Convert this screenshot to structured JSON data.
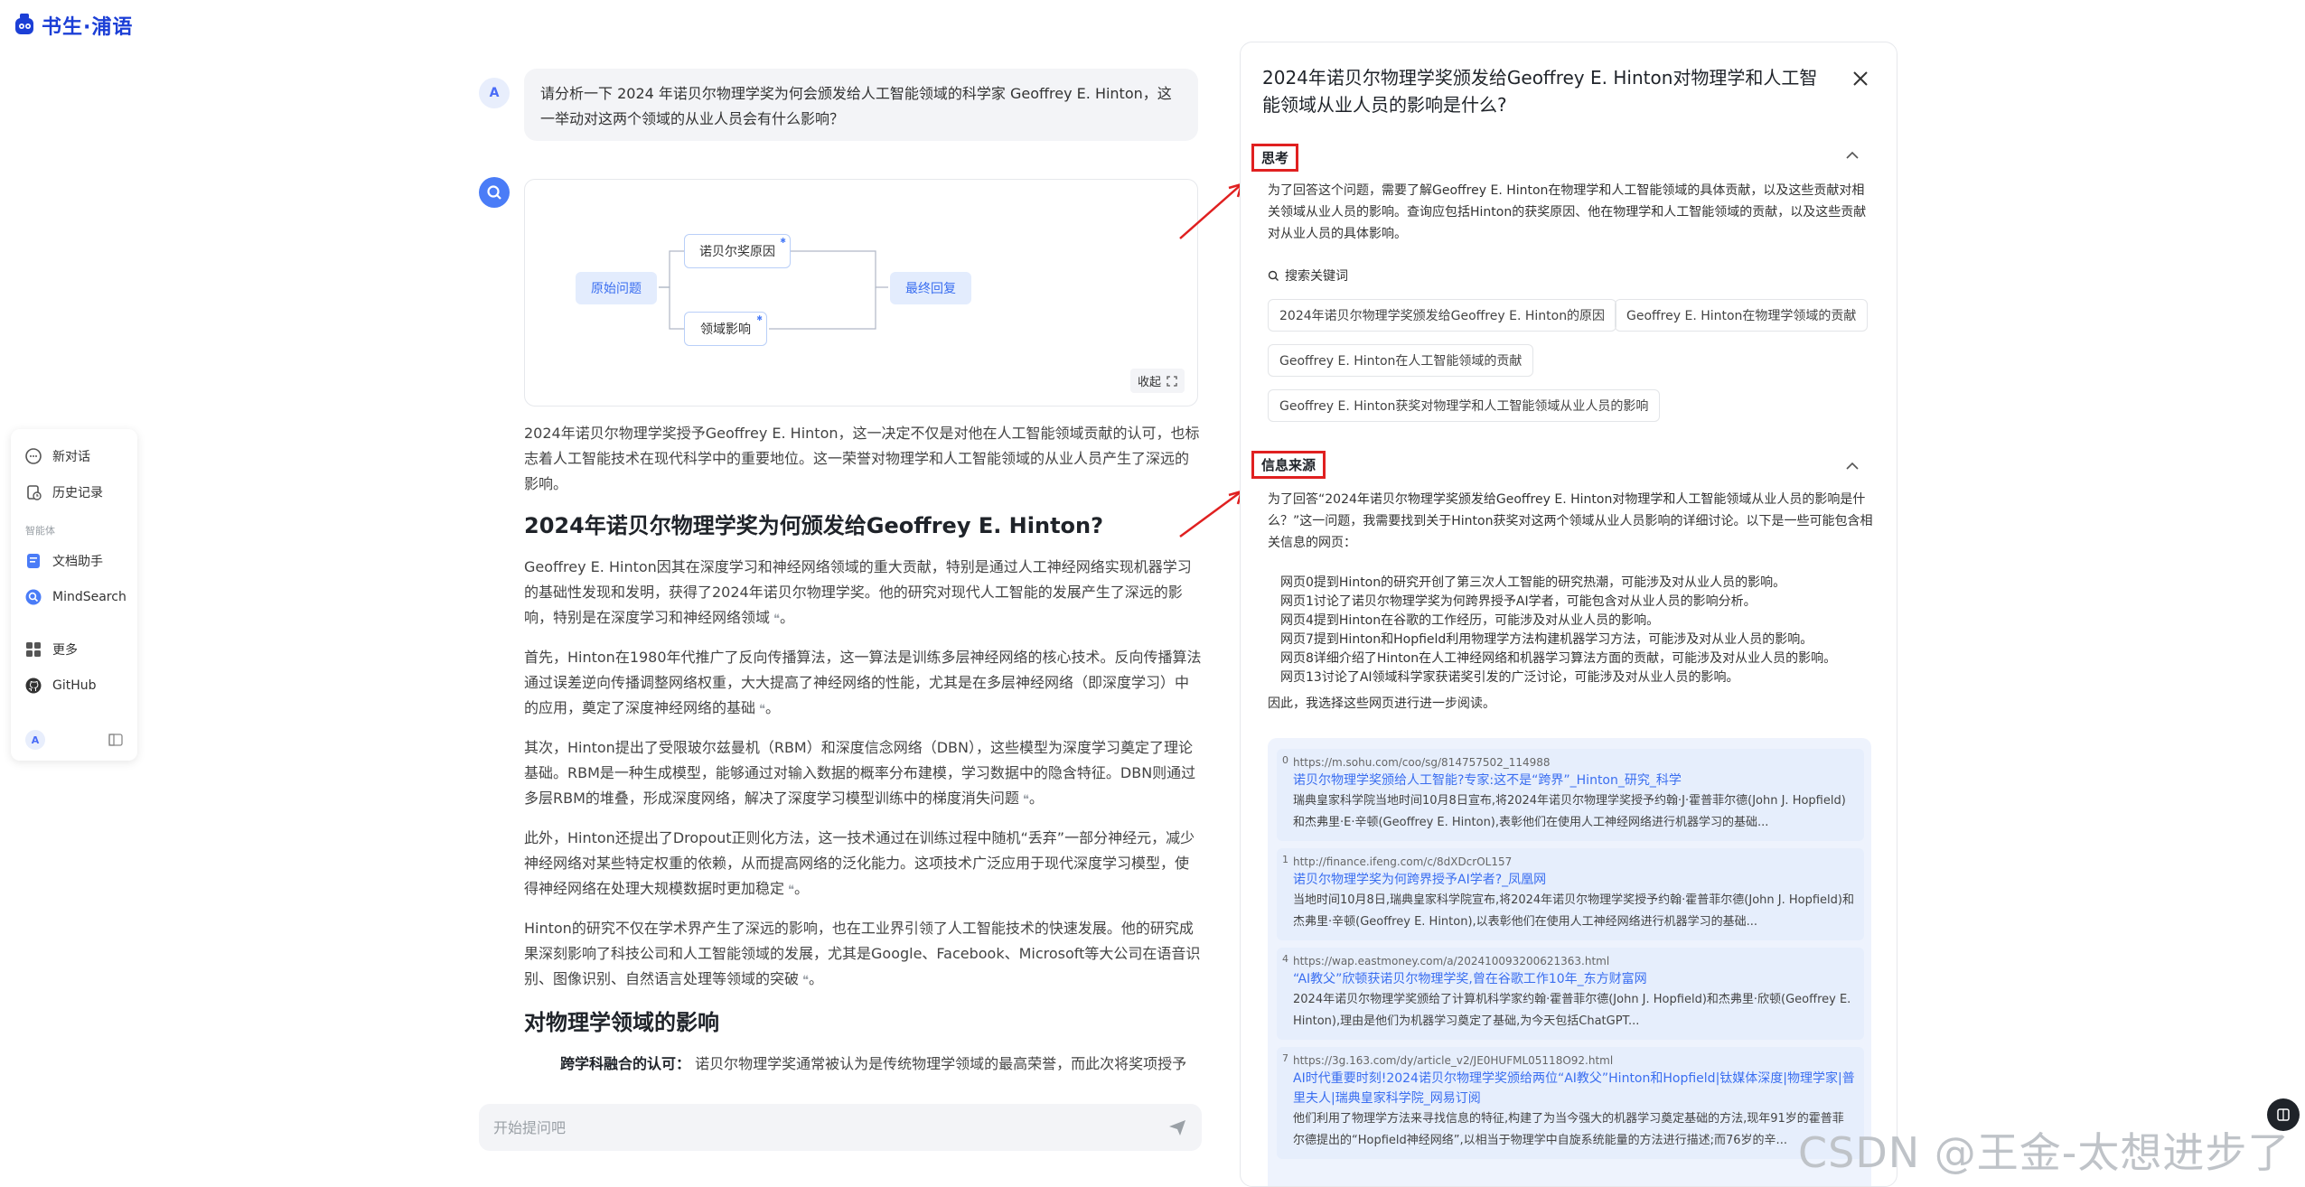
{
  "app": {
    "logo_text": "书生·浦语"
  },
  "sidebar": {
    "new_chat": "新对话",
    "history": "历史记录",
    "section_label": "智能体",
    "agents": [
      "文档助手",
      "MindSearch"
    ],
    "more": "更多",
    "github": "GitHub",
    "avatar_letter": "A"
  },
  "chat": {
    "user_avatar": "A",
    "question": "请分析一下 2024 年诺贝尔物理学奖为何会颁发给人工智能领域的科学家 Geoffrey E. Hinton，这一举动对这两个领域的从业人员会有什么影响？",
    "flow": {
      "start": "原始问题",
      "nodes": [
        "诺贝尔奖原因",
        "领域影响"
      ],
      "end": "最终回复",
      "collapse": "收起"
    },
    "answer": {
      "intro": "2024年诺贝尔物理学奖授予Geoffrey E. Hinton，这一决定不仅是对他在人工智能领域贡献的认可，也标志着人工智能技术在现代科学中的重要地位。这一荣誉对物理学和人工智能领域的从业人员产生了深远的影响。",
      "h1": "2024年诺贝尔物理学奖为何颁发给Geoffrey E. Hinton?",
      "p1": "Geoffrey E. Hinton因其在深度学习和神经网络领域的重大贡献，特别是通过人工神经网络实现机器学习的基础性发现和发明，获得了2024年诺贝尔物理学奖。他的研究对现代人工智能的发展产生了深远的影响，特别是在深度学习和神经网络领域",
      "p2": "首先，Hinton在1980年代推广了反向传播算法，这一算法是训练多层神经网络的核心技术。反向传播算法通过误差逆向传播调整网络权重，大大提高了神经网络的性能，尤其是在多层神经网络（即深度学习）中的应用，奠定了深度神经网络的基础",
      "p3": "其次，Hinton提出了受限玻尔兹曼机（RBM）和深度信念网络（DBN），这些模型为深度学习奠定了理论基础。RBM是一种生成模型，能够通过对输入数据的概率分布建模，学习数据中的隐含特征。DBN则通过多层RBM的堆叠，形成深度网络，解决了深度学习模型训练中的梯度消失问题",
      "p4": "此外，Hinton还提出了Dropout正则化方法，这一技术通过在训练过程中随机“丢弃”一部分神经元，减少神经网络对某些特定权重的依赖，从而提高网络的泛化能力。这项技术广泛应用于现代深度学习模型，使得神经网络在处理大规模数据时更加稳定",
      "p5": "Hinton的研究不仅在学术界产生了深远的影响，也在工业界引领了人工智能技术的快速发展。他的研究成果深刻影响了科技公司和人工智能领域的发展，尤其是Google、Facebook、Microsoft等大公司在语音识别、图像识别、自然语言处理等领域的突破",
      "h2": "对物理学领域的影响",
      "p6_bold": "跨学科融合的认可：",
      "p6": "诺贝尔物理学奖通常被认为是传统物理学领域的最高荣誉，而此次将奖项授予"
    },
    "input_placeholder": "开始提问吧"
  },
  "panel": {
    "title": "2024年诺贝尔物理学奖颁发给Geoffrey E. Hinton对物理学和人工智能领域从业人员的影响是什么?",
    "think_label": "思考",
    "think_text": "为了回答这个问题，需要了解Geoffrey E. Hinton在物理学和人工智能领域的具体贡献，以及这些贡献对相关领域从业人员的影响。查询应包括Hinton的获奖原因、他在物理学和人工智能领域的贡献，以及这些贡献对从业人员的具体影响。",
    "search_label": "搜索关键词",
    "keywords": [
      "2024年诺贝尔物理学奖颁发给Geoffrey E. Hinton的原因",
      "Geoffrey E. Hinton在物理学领域的贡献",
      "Geoffrey E. Hinton在人工智能领域的贡献",
      "Geoffrey E. Hinton获奖对物理学和人工智能领域从业人员的影响"
    ],
    "source_label": "信息来源",
    "source_text": "为了回答“2024年诺贝尔物理学奖颁发给Geoffrey E. Hinton对物理学和人工智能领域从业人员的影响是什么？”这一问题，我需要找到关于Hinton获奖对这两个领域从业人员影响的详细讨论。以下是一些可能包含相关信息的网页：",
    "source_items": [
      "网页0提到Hinton的研究开创了第三次人工智能的研究热潮，可能涉及对从业人员的影响。",
      "网页1讨论了诺贝尔物理学奖为何跨界授予AI学者，可能包含对从业人员的影响分析。",
      "网页4提到Hinton在谷歌的工作经历，可能涉及对从业人员的影响。",
      "网页7提到Hinton和Hopfield利用物理学方法构建机器学习方法，可能涉及对从业人员的影响。",
      "网页8详细介绍了Hinton在人工神经网络和机器学习算法方面的贡献，可能涉及对从业人员的影响。",
      "网页13讨论了AI领域科学家获诺奖引发的广泛讨论，可能涉及对从业人员的影响。"
    ],
    "conclusion": "因此，我选择这些网页进行进一步阅读。",
    "results": [
      {
        "idx": "0",
        "url": "https://m.sohu.com/coo/sg/814757502_114988",
        "title": "诺贝尔物理学奖颁给人工智能?专家:这不是“跨界”_Hinton_研究_科学",
        "desc": "瑞典皇家科学院当地时间10月8日宣布,将2024年诺贝尔物理学奖授予约翰·J·霍普菲尔德(John J. Hopfield)和杰弗里·E·辛顿(Geoffrey E. Hinton),表彰他们在使用人工神经网络进行机器学习的基础..."
      },
      {
        "idx": "1",
        "url": "http://finance.ifeng.com/c/8dXDcrOL157",
        "title": "诺贝尔物理学奖为何跨界授予AI学者?_凤凰网",
        "desc": "当地时间10月8日,瑞典皇家科学院宣布,将2024年诺贝尔物理学奖授予约翰·霍普菲尔德(John J. Hopfield)和杰弗里·辛顿(Geoffrey E. Hinton),以表彰他们在使用人工神经网络进行机器学习的基础..."
      },
      {
        "idx": "4",
        "url": "https://wap.eastmoney.com/a/202410093200621363.html",
        "title": "“AI教父”欣顿获诺贝尔物理学奖,曾在谷歌工作10年_东方财富网",
        "desc": "2024年诺贝尔物理学奖颁给了计算机科学家约翰·霍普菲尔德(John J. Hopfield)和杰弗里·欣顿(Geoffrey E. Hinton),理由是他们为机器学习奠定了基础,为今天包括ChatGPT..."
      },
      {
        "idx": "7",
        "url": "https://3g.163.com/dy/article_v2/JE0HUFML05118O92.html",
        "title": "AI时代重要时刻!2024诺贝尔物理学奖颁给两位“AI教父”Hinton和Hopfield|钛媒体深度|物理学家|普里夫人|瑞典皇家科学院_网易订阅",
        "desc": "他们利用了物理学方法来寻找信息的特征,构建了为当今强大的机器学习奠定基础的方法,现年91岁的霍普菲尔德提出的“Hopfield神经网络”,以相当于物理学中自旋系统能量的方法进行描述;而76岁的辛..."
      }
    ]
  },
  "watermark": "CSDN @王金-太想进步了"
}
